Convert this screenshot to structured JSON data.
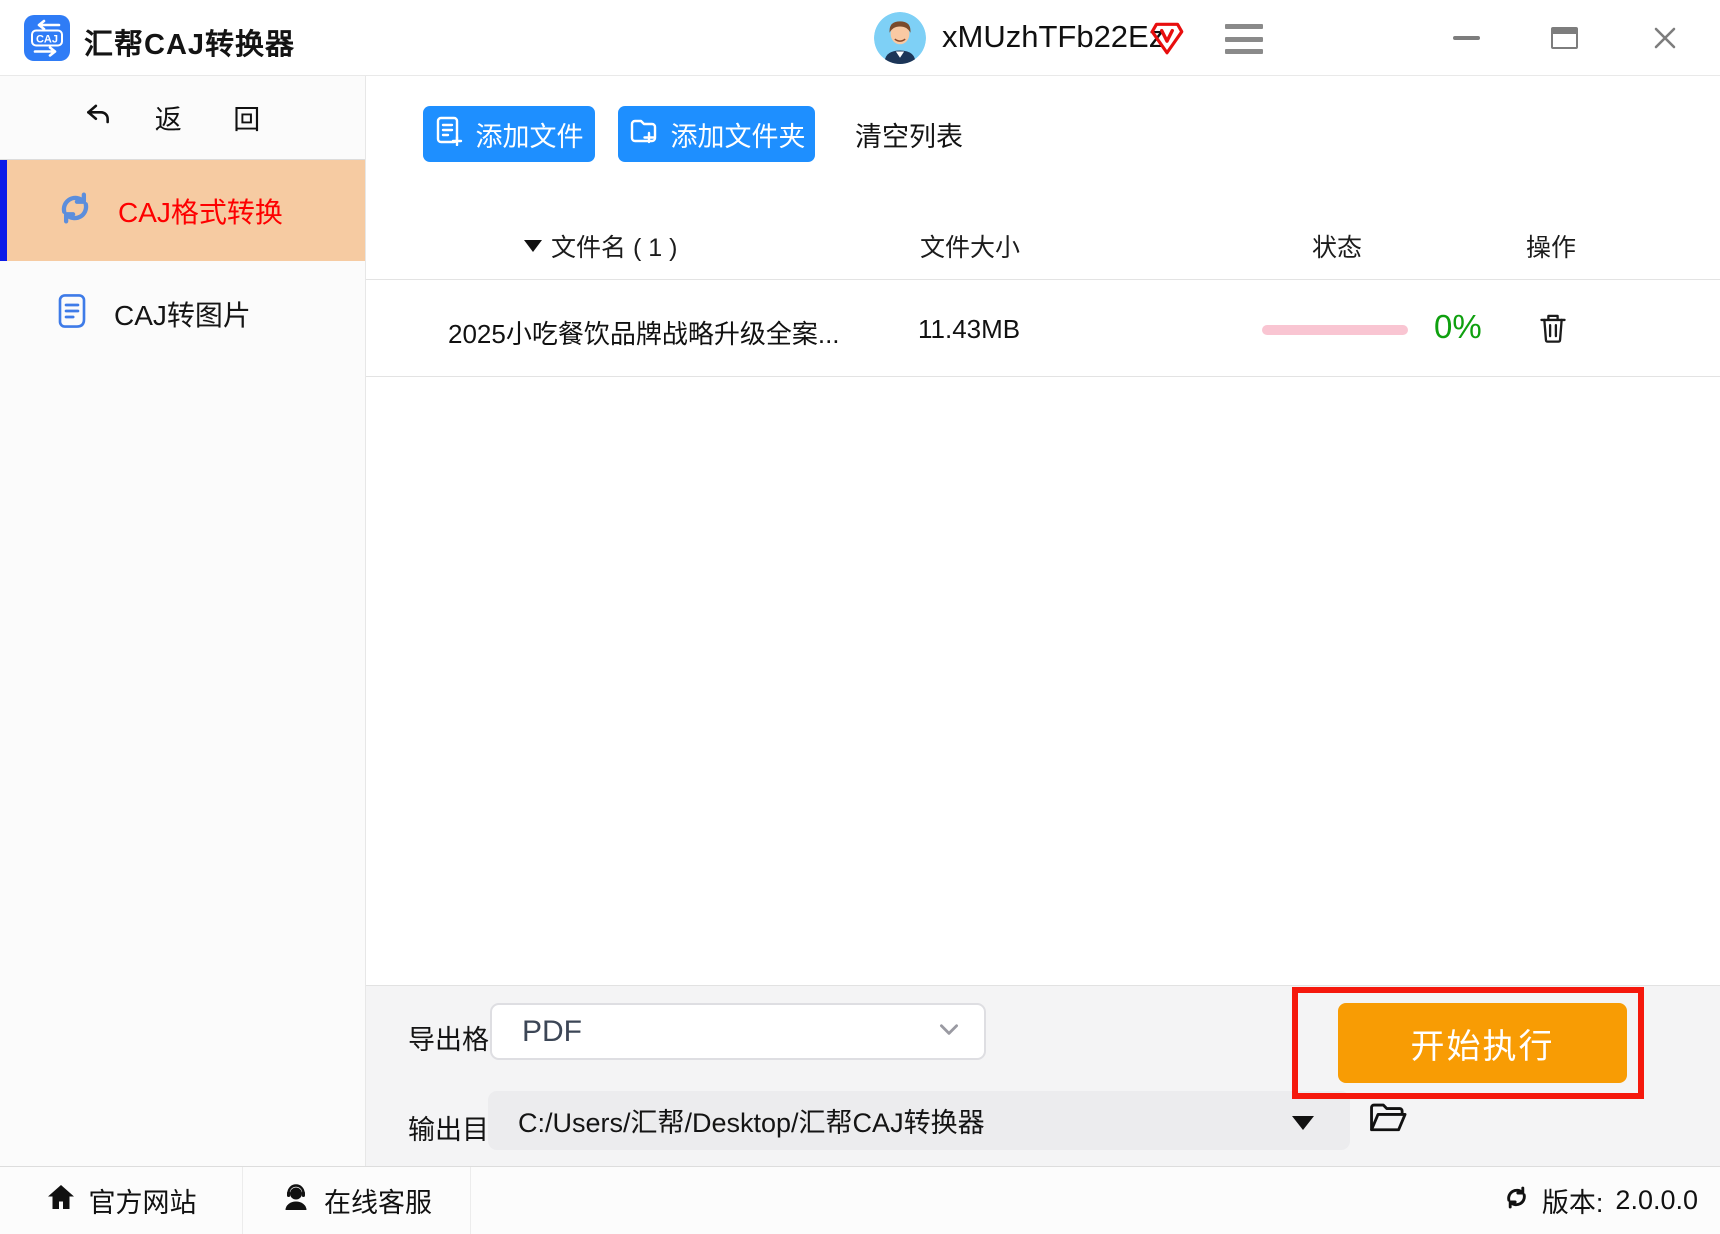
{
  "titlebar": {
    "logo_text": "CAJ",
    "app_title": "汇帮CAJ转换器",
    "username": "xMUzhTFb22Ez"
  },
  "sidebar": {
    "back_label": "返 回",
    "items": [
      {
        "label": "CAJ格式转换",
        "active": true
      },
      {
        "label": "CAJ转图片",
        "active": false
      }
    ]
  },
  "toolbar": {
    "add_file_label": "添加文件",
    "add_folder_label": "添加文件夹",
    "clear_list_label": "清空列表"
  },
  "file_table": {
    "columns": {
      "name": "文件名 ( 1 )",
      "size": "文件大小",
      "status": "状态",
      "action": "操作"
    },
    "rows": [
      {
        "name": "2025小吃餐饮品牌战略升级全案...",
        "size": "11.43MB",
        "progress_percent": "0%",
        "progress_value": 0
      }
    ]
  },
  "export_panel": {
    "format_label": "导出格式:",
    "format_value": "PDF",
    "output_label": "输出目录:",
    "output_path": "C:/Users/汇帮/Desktop/汇帮CAJ转换器",
    "start_button_label": "开始执行"
  },
  "footer": {
    "website_label": "官方网站",
    "support_label": "在线客服",
    "version_label": "版本:",
    "version_value": "2.0.0.0"
  },
  "colors": {
    "primary_blue": "#1E8FFF",
    "logo_blue": "#2F7CF6",
    "sidebar_active_bg": "#F6CBA2",
    "sidebar_active_text": "#FE0000",
    "active_bar_blue": "#0B1BE8",
    "start_orange": "#F89C04",
    "highlight_red": "#F5180C",
    "progress_pink": "#F9C5D2",
    "percent_green": "#0FA00F",
    "vip_red": "#E80E0E"
  }
}
